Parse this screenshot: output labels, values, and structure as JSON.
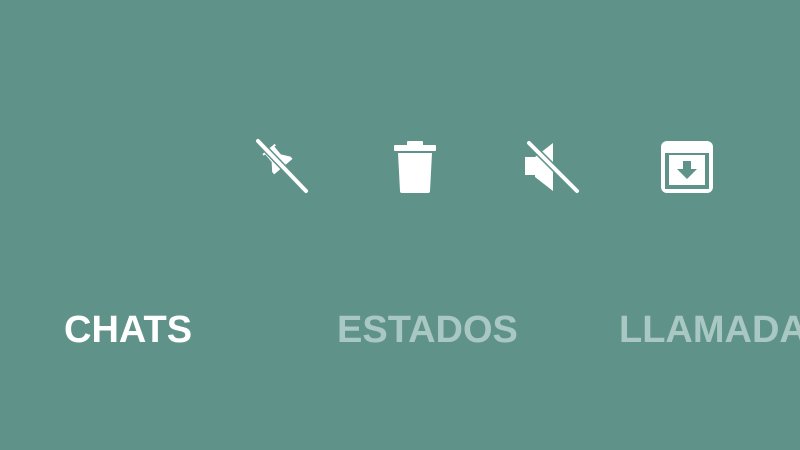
{
  "colors": {
    "background": "#5f938a",
    "active_tab": "#ffffff",
    "inactive_tab": "#a9c8c3",
    "icon": "#ffffff"
  },
  "toolbar": {
    "icons": [
      {
        "name": "unpin-icon"
      },
      {
        "name": "delete-icon"
      },
      {
        "name": "unmute-icon"
      },
      {
        "name": "archive-icon"
      }
    ]
  },
  "tabs": {
    "chats": "CHATS",
    "status": "ESTADOS",
    "calls": "LLAMADAS"
  }
}
